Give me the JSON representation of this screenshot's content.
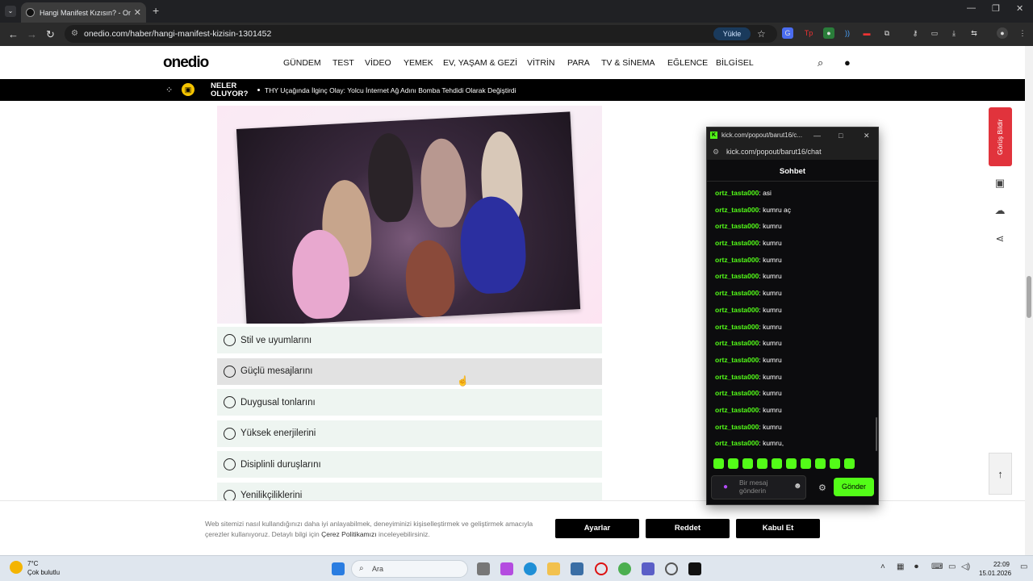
{
  "browser": {
    "tab_title": "Hangi Manifest Kızısın? - Onedi",
    "url": "onedio.com/haber/hangi-manifest-kizisin-1301452",
    "upload_label": "Yükle"
  },
  "site": {
    "logo": "onedio",
    "menu": [
      "GÜNDEM",
      "TEST",
      "VİDEO",
      "YEMEK",
      "EV, YAŞAM & GEZİ",
      "VİTRİN",
      "PARA",
      "TV & SİNEMA",
      "EĞLENCE",
      "BİLGİSEL"
    ],
    "ticker_label_line1": "NELER",
    "ticker_label_line2": "OLUYOR?",
    "ticker_text": "THY Uçağında İlginç Olay: Yolcu İnternet Ağ Adını Bomba Tehdidi Olarak Değiştirdi",
    "feedback_label": "Görüş Bildir"
  },
  "quiz": {
    "options": [
      "Stil ve uyumlarını",
      "Güçlü mesajlarını",
      "Duygusal tonlarını",
      "Yüksek enerjilerini",
      "Disiplinli duruşlarını",
      "Yenilikçiliklerini"
    ]
  },
  "cookie": {
    "text": "Web sitemizi nasıl kullandığınızı daha iyi anlayabilmek, deneyiminizi kişiselleştirmek ve geliştirmek amacıyla çerezler kullanıyoruz. Detaylı bilgi için",
    "link": "Çerez Politikamızı",
    "text_end": "inceleyebilirsiniz.",
    "buttons": [
      "Ayarlar",
      "Reddet",
      "Kabul Et"
    ]
  },
  "popup": {
    "title": "kick.com/popout/barut16/c...",
    "url": "kick.com/popout/barut16/chat",
    "header": "Sohbet",
    "messages": [
      {
        "user": "ortz_tasta000",
        "text": "asi"
      },
      {
        "user": "ortz_tasta000",
        "text": "kumru aç"
      },
      {
        "user": "ortz_tasta000",
        "text": "kumru"
      },
      {
        "user": "ortz_tasta000",
        "text": "kumru"
      },
      {
        "user": "ortz_tasta000",
        "text": "kumru"
      },
      {
        "user": "ortz_tasta000",
        "text": "kumru"
      },
      {
        "user": "ortz_tasta000",
        "text": "kumru"
      },
      {
        "user": "ortz_tasta000",
        "text": "kumru"
      },
      {
        "user": "ortz_tasta000",
        "text": "kumru"
      },
      {
        "user": "ortz_tasta000",
        "text": "kumru"
      },
      {
        "user": "ortz_tasta000",
        "text": "kumru"
      },
      {
        "user": "ortz_tasta000",
        "text": "kumru"
      },
      {
        "user": "ortz_tasta000",
        "text": "kumru"
      },
      {
        "user": "ortz_tasta000",
        "text": "kumru"
      },
      {
        "user": "ortz_tasta000",
        "text": "kumru"
      },
      {
        "user": "ortz_tasta000",
        "text": "kumru,"
      }
    ],
    "input_placeholder_line1": "Bir mesaj",
    "input_placeholder_line2": "gönderin",
    "send_label": "Gönder",
    "accent_color": "#53fc18"
  },
  "taskbar": {
    "temp": "7°C",
    "weather": "Çok bulutlu",
    "search": "Ara",
    "time": "22:09",
    "date": "15.01.2026"
  }
}
